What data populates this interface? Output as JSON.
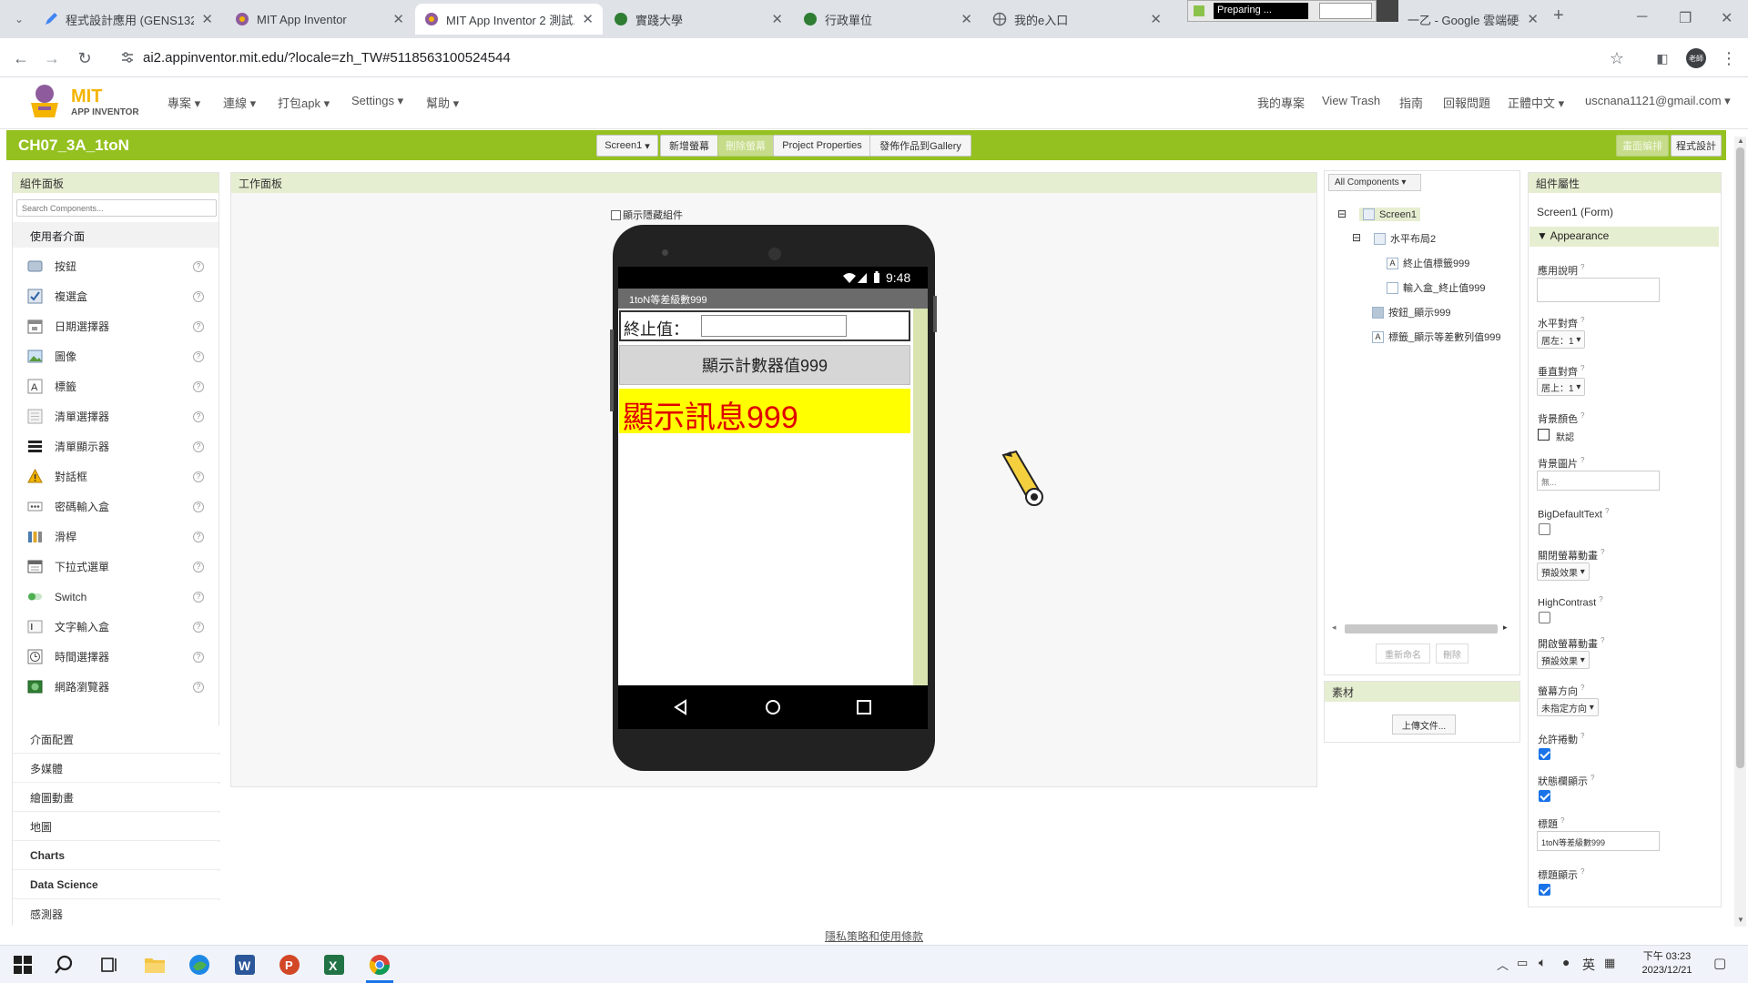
{
  "browser": {
    "tabs": [
      {
        "title": "程式設計應用 (GENS132..."
      },
      {
        "title": "MIT App Inventor"
      },
      {
        "title": "MIT App Inventor 2 測試..."
      },
      {
        "title": "實踐大學"
      },
      {
        "title": "行政單位"
      },
      {
        "title": "我的e入口"
      },
      {
        "title": "Preparing ..."
      },
      {
        "title": "一乙 - Google 雲端硬碟"
      }
    ],
    "url": "ai2.appinventor.mit.edu/?locale=zh_TW#5118563100524544",
    "avatar_text": "老師"
  },
  "app": {
    "logo_title": "MIT",
    "logo_sub": "APP INVENTOR",
    "menu": [
      "專案",
      "連線",
      "打包apk",
      "Settings",
      "幫助"
    ],
    "right_menu": [
      "我的專案",
      "View Trash",
      "指南",
      "回報問題",
      "正體中文"
    ],
    "user": "uscnana1121@gmail.com",
    "project_name": "CH07_3A_1toN",
    "toolbar": {
      "screen": "Screen1",
      "add_screen": "新增螢幕",
      "remove_screen": "刪除螢幕",
      "project_properties": "Project Properties",
      "publish": "發佈作品到Gallery",
      "designer": "畫面編排",
      "blocks": "程式設計"
    }
  },
  "palette": {
    "header": "組件面板",
    "search_placeholder": "Search Components...",
    "category": "使用者介面",
    "items": [
      "按鈕",
      "複選盒",
      "日期選擇器",
      "圖像",
      "標籤",
      "清單選擇器",
      "清單顯示器",
      "對話框",
      "密碼輸入盒",
      "滑桿",
      "下拉式選單",
      "Switch",
      "文字輸入盒",
      "時間選擇器",
      "網路瀏覽器"
    ],
    "categories": [
      "介面配置",
      "多媒體",
      "繪圖動畫",
      "地圖",
      "Charts",
      "Data Science",
      "感測器"
    ]
  },
  "viewer": {
    "header": "工作面板",
    "show_hidden": "顯示隱藏組件",
    "phone": {
      "time": "9:48",
      "title": "1toN等差級數999",
      "label_end": "終止值：",
      "button": "顯示計數器值999",
      "message": "顯示訊息999"
    }
  },
  "tree": {
    "dropdown": "All Components",
    "nodes": [
      "Screen1",
      "水平布局2",
      "終止值標籤999",
      "輸入盒_終止值999",
      "按鈕_顯示999",
      "標籤_顯示等差數列值999"
    ],
    "rename": "重新命名",
    "delete": "刪除"
  },
  "media": {
    "header": "素材",
    "upload": "上傳文件..."
  },
  "props": {
    "header": "組件屬性",
    "component": "Screen1 (Form)",
    "section": "Appearance",
    "about": "應用說明",
    "align_h": "水平對齊",
    "align_h_val": "居左：1",
    "align_v": "垂直對齊",
    "align_v_val": "居上：1",
    "bg_color": "背景顏色",
    "bg_color_val": "默認",
    "bg_image": "背景圖片",
    "bg_image_val": "無...",
    "big_text": "BigDefaultText",
    "close_anim": "關閉螢幕動畫",
    "close_anim_val": "預設效果",
    "high_contrast": "HighContrast",
    "open_anim": "開啟螢幕動畫",
    "open_anim_val": "預設效果",
    "orientation": "螢幕方向",
    "orientation_val": "未指定方向",
    "scrollable": "允許捲動",
    "show_status": "狀態欄顯示",
    "title": "標題",
    "title_val": "1toN等差級數999",
    "title_visible": "標題顯示"
  },
  "footer": "隱私策略和使用條款",
  "taskbar": {
    "ime": "英",
    "time": "下午 03:23",
    "date": "2023/12/21"
  },
  "colors": {
    "green_bar": "#94c11f",
    "message_bg": "#ffff00",
    "message_text": "#e00000"
  }
}
